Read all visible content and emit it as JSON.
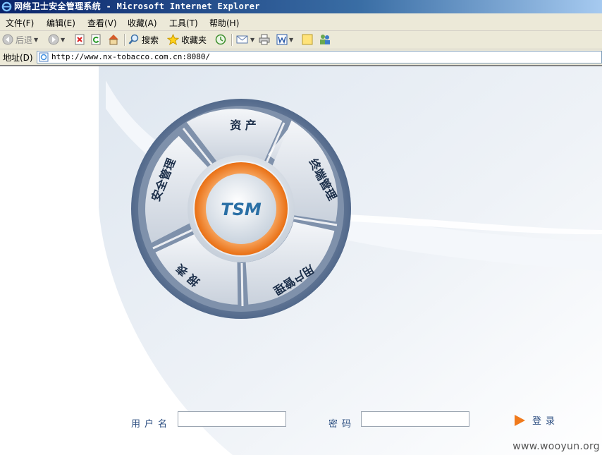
{
  "window": {
    "title": "网络卫士安全管理系统 - Microsoft Internet Explorer"
  },
  "menu": [
    {
      "label": "文件(F)"
    },
    {
      "label": "编辑(E)"
    },
    {
      "label": "查看(V)"
    },
    {
      "label": "收藏(A)"
    },
    {
      "label": "工具(T)"
    },
    {
      "label": "帮助(H)"
    }
  ],
  "toolbar": {
    "back_label": "后退",
    "search_label": "搜索",
    "favorites_label": "收藏夹"
  },
  "address": {
    "label": "地址(D)",
    "url": "http://www.nx-tobacco.com.cn:8080/"
  },
  "wheel": {
    "center_label": "TSM",
    "segments": [
      {
        "label": "资 产"
      },
      {
        "label": "终端管理"
      },
      {
        "label": "用户管理"
      },
      {
        "label": "报 表"
      },
      {
        "label": "安全管理"
      }
    ],
    "accent_color": "#f08a2c",
    "text_color": "#2a4f7c"
  },
  "login": {
    "username_label": "用户名",
    "username_value": "",
    "password_label": "密码",
    "password_value": "",
    "submit_label": "登录"
  },
  "watermark": "www.wooyun.org"
}
